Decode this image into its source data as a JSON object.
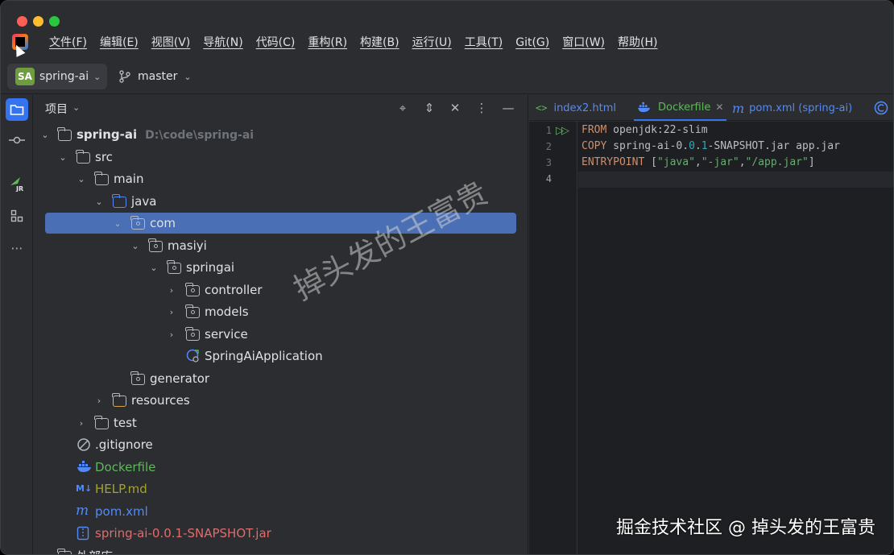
{
  "menu": [
    "文件(F)",
    "编辑(E)",
    "视图(V)",
    "导航(N)",
    "代码(C)",
    "重构(R)",
    "构建(B)",
    "运行(U)",
    "工具(T)",
    "Git(G)",
    "窗口(W)",
    "帮助(H)"
  ],
  "toolbar": {
    "project_badge": "SA",
    "project_name": "spring-ai",
    "branch": "master"
  },
  "panel": {
    "title": "项目"
  },
  "tree": [
    {
      "label": "spring-ai",
      "extra": "D:\\code\\spring-ai",
      "bold": true,
      "color": "#dfe1e5"
    },
    {
      "label": "src",
      "color": "#dfe1e5"
    },
    {
      "label": "main",
      "color": "#dfe1e5"
    },
    {
      "label": "java",
      "color": "#dfe1e5"
    },
    {
      "label": "com",
      "color": "#dfe1e5"
    },
    {
      "label": "masiyi",
      "color": "#dfe1e5"
    },
    {
      "label": "springai",
      "color": "#dfe1e5"
    },
    {
      "label": "controller",
      "color": "#dfe1e5"
    },
    {
      "label": "models",
      "color": "#dfe1e5"
    },
    {
      "label": "service",
      "color": "#dfe1e5"
    },
    {
      "label": "SpringAiApplication",
      "color": "#dfe1e5"
    },
    {
      "label": "generator",
      "color": "#dfe1e5"
    },
    {
      "label": "resources",
      "color": "#dfe1e5"
    },
    {
      "label": "test",
      "color": "#dfe1e5"
    },
    {
      "label": ".gitignore",
      "color": "#dfe1e5"
    },
    {
      "label": "Dockerfile",
      "color": "#5fb85a"
    },
    {
      "label": "HELP.md",
      "color": "#a3a330"
    },
    {
      "label": "pom.xml",
      "color": "#548af7"
    },
    {
      "label": "spring-ai-0.0.1-SNAPSHOT.jar",
      "color": "#e06c6c"
    },
    {
      "label": "外部库",
      "color": "#dfe1e5"
    }
  ],
  "tabs": [
    {
      "label": "index2.html"
    },
    {
      "label": "Dockerfile"
    },
    {
      "label": "pom.xml (spring-ai)"
    }
  ],
  "editor": {
    "line_numbers": [
      "1",
      "2",
      "3",
      "4"
    ],
    "line1_kw": "FROM",
    "line1_rest": " openjdk:22-slim",
    "line2_kw": "COPY",
    "line2_a": " spring-ai-0.",
    "line2_num": "0",
    "line2_b": ".",
    "line2_num2": "1",
    "line2_c": "-SNAPSHOT.jar app.jar",
    "line3_kw": "ENTRYPOINT",
    "line3_open": " [",
    "line3_s1": "\"java\"",
    "line3_c1": ",",
    "line3_s2": "\"-jar\"",
    "line3_c2": ",",
    "line3_s3": "\"/app.jar\"",
    "line3_close": "]"
  },
  "watermark_diag": "掉头发的王富贵",
  "watermark_corner": "掘金技术社区 @ 掉头发的王富贵",
  "colors": {
    "accent": "#3574f0",
    "selection": "#4a6fb5",
    "editor_bg": "#1e1f22",
    "panel_bg": "#2b2d30"
  }
}
